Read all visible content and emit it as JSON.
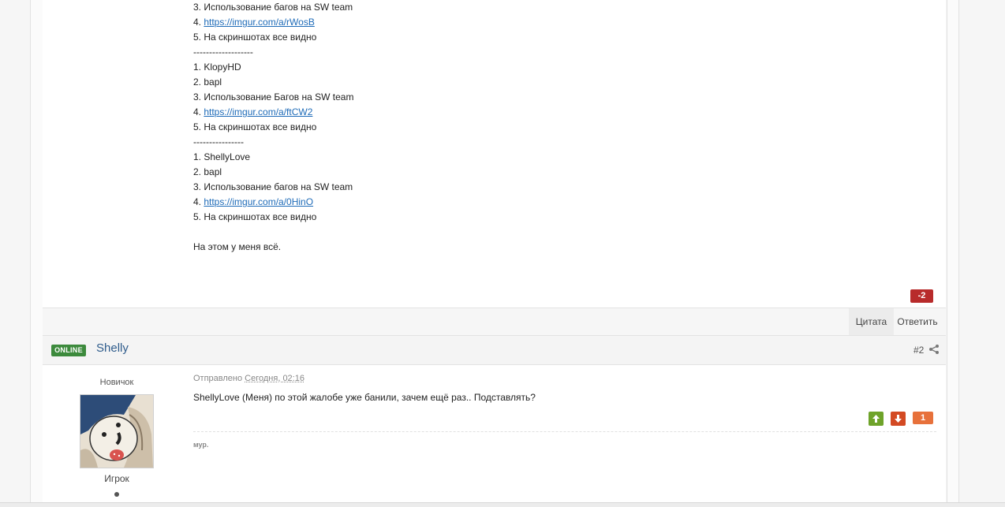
{
  "post1": {
    "lines": [
      {
        "text": "3. Использование багов на SW team"
      },
      {
        "prefix": "4. ",
        "link": "https://imgur.com/a/rWosB"
      },
      {
        "text": "5. На скриншотах все видно"
      },
      {
        "text": "-------------------"
      },
      {
        "text": "1. KlopyHD"
      },
      {
        "text": "2. bapl"
      },
      {
        "text": "3. Использование Багов на SW team"
      },
      {
        "prefix": "4. ",
        "link": "https://imgur.com/a/ftCW2"
      },
      {
        "text": "5. На скриншотах все видно"
      },
      {
        "text": "----------------"
      },
      {
        "text": "1. ShellyLove"
      },
      {
        "text": "2. bapl"
      },
      {
        "text": "3. Использование багов на SW team"
      },
      {
        "prefix": "4. ",
        "link": "https://imgur.com/a/0HinO"
      },
      {
        "text": "5. На скриншотах все видно"
      },
      {
        "text": ""
      },
      {
        "text": "На этом у меня всё."
      }
    ],
    "reputation": "-2",
    "actions": {
      "quote": "Цитата",
      "reply": "Ответить"
    }
  },
  "post2": {
    "online_badge": "ONLINE",
    "author": "Shelly",
    "post_number": "#2",
    "rank": "Новичок",
    "group": "Игрок",
    "sent_label": "Отправлено",
    "sent_date": "Сегодня, 02:16",
    "text": "ShellyLove (Меня) по этой жалобе уже банили, зачем ещё раз.. Подставлять?",
    "vote_score": "1",
    "signature": "мур."
  },
  "colors": {
    "online": "#3c8a3c",
    "author_link": "#2f5c8c",
    "rep_negative": "#b82b2b",
    "vote_up": "#6ea32a",
    "vote_down": "#d34a23",
    "vote_score": "#e7713b",
    "link": "#1e6bb8"
  },
  "icons": {
    "share": "share-icon",
    "vote_up": "arrow-up-icon",
    "vote_down": "arrow-down-icon"
  }
}
